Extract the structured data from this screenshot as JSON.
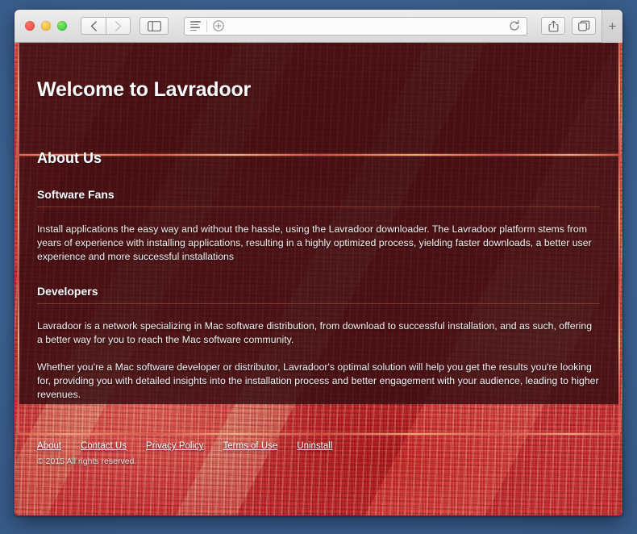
{
  "window": {
    "traffic_lights": [
      {
        "name": "close",
        "color": "#e8453c"
      },
      {
        "name": "minimize",
        "color": "#efaf21"
      },
      {
        "name": "maximize",
        "color": "#2bc231"
      }
    ],
    "toolbar": {
      "back_icon": "chevron-left-icon",
      "forward_icon": "chevron-right-icon",
      "sidebar_icon": "sidebar-toggle-icon",
      "reader_icon": "reader-view-icon",
      "add_bookmark_icon": "plus-circle-icon",
      "reload_icon": "reload-icon",
      "share_icon": "share-icon",
      "tabs_icon": "show-tabs-icon",
      "new_tab_label": "+",
      "address_value": "",
      "address_placeholder": ""
    }
  },
  "page": {
    "title": "Welcome to Lavradoor",
    "about_heading": "About Us",
    "sections": [
      {
        "heading": "Software Fans",
        "paragraphs": [
          "Install applications the easy way and without the hassle, using the Lavradoor downloader. The Lavradoor platform stems from years of experience with installing applications, resulting in a highly optimized process, yielding faster downloads, a better user experience and more successful installations"
        ]
      },
      {
        "heading": "Developers",
        "paragraphs": [
          "Lavradoor is a network specializing in Mac software distribution, from download to successful installation, and as such, offering a better way for you to reach the Mac software community.",
          "Whether you're a Mac software developer or distributor, Lavradoor's optimal solution will help you get the results you're looking for, providing you with detailed insights into the installation process and better engagement with your audience, leading to higher revenues."
        ]
      }
    ],
    "footer": {
      "links": [
        {
          "label": "About"
        },
        {
          "label": "Contact Us"
        },
        {
          "label": "Privacy Policy"
        },
        {
          "label": "Terms of Use"
        },
        {
          "label": "Uninstall"
        }
      ],
      "copyright": "© 2015 All rights reserved."
    }
  },
  "colors": {
    "accent_red": "#d9544b",
    "panel_overlay": "rgba(48,10,14,.80)",
    "fabric_base": "#bd4347",
    "desktop": "#3c6293"
  }
}
